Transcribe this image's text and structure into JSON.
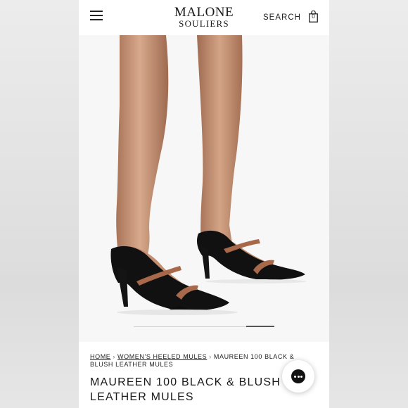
{
  "header": {
    "brand_line1": "MALONE",
    "brand_line2": "SOULIERS",
    "search_label": "SEARCH",
    "bag_count": "0",
    "icons": [
      "menu-icon",
      "shopping-bag-icon"
    ]
  },
  "gallery": {
    "progress": 0.2,
    "image_subject": "legs-wearing-black-heeled-mules-with-tan-straps"
  },
  "breadcrumb": {
    "home": "HOME",
    "category": "WOMEN'S HEELED MULES",
    "current": "MAUREEN 100 BLACK & BLUSH LEATHER MULES"
  },
  "product": {
    "title": "MAUREEN 100 BLACK & BLUSH LEATHER MULES"
  },
  "chat": {
    "icon": "chat-bubble-icon"
  },
  "colors": {
    "leather": "#111111",
    "strap": "#a8684a",
    "skin": "#c99678"
  }
}
